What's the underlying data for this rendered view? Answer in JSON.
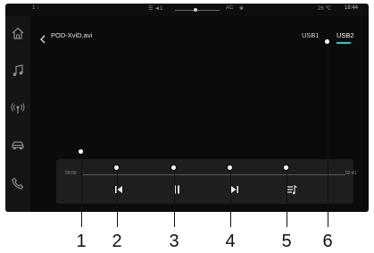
{
  "status_bar": {
    "left_glyph": "1 ↕",
    "source_label": "☰ ◄1",
    "ac_label": "AC",
    "temperature": "26 ℃",
    "time": "18:44"
  },
  "sidebar": {
    "items": [
      {
        "icon": "home-icon"
      },
      {
        "icon": "music-icon"
      },
      {
        "icon": "radio-icon"
      },
      {
        "icon": "car-icon"
      },
      {
        "icon": "phone-icon"
      }
    ]
  },
  "header": {
    "title": "POD-XviD.avi",
    "tabs": [
      {
        "label": "USB1",
        "active": false
      },
      {
        "label": "USB2",
        "active": true
      }
    ],
    "accent_color": "#2fc7c3"
  },
  "player": {
    "elapsed": "00:00",
    "duration": "02:41",
    "progress_fraction": 0.0,
    "controls": [
      {
        "name": "previous-button",
        "icon": "previous-track-icon"
      },
      {
        "name": "pause-button",
        "icon": "pause-icon"
      },
      {
        "name": "next-button",
        "icon": "next-track-icon"
      },
      {
        "name": "playlist-button",
        "icon": "playlist-icon"
      }
    ]
  },
  "callouts": [
    "1",
    "2",
    "3",
    "4",
    "5",
    "6"
  ]
}
